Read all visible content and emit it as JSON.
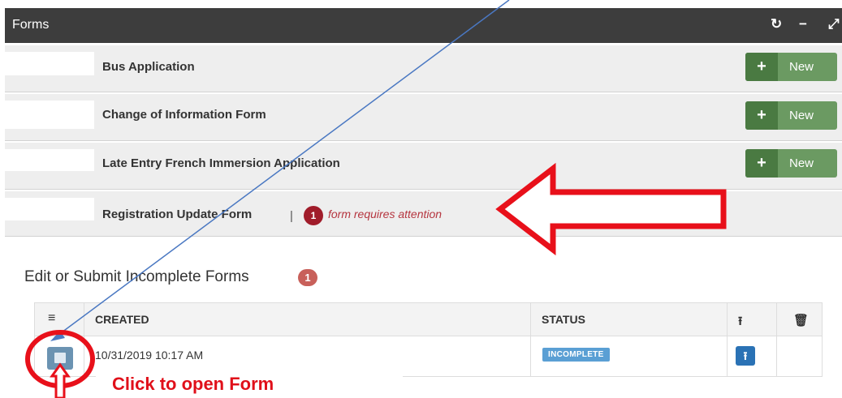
{
  "header": {
    "title": "Forms",
    "refresh_icon": "refresh-icon",
    "minimize_icon": "minus-icon",
    "expand_icon": "expand-icon"
  },
  "forms": [
    {
      "name": "Bus Application",
      "new_label": "New"
    },
    {
      "name": "Change of Information Form",
      "new_label": "New"
    },
    {
      "name": "Late Entry French Immersion Application",
      "new_label": "New"
    },
    {
      "name": "Registration Update Form",
      "separator": "|",
      "attention_count": "1",
      "attention_text": "form requires attention"
    }
  ],
  "incomplete": {
    "title": "Edit or Submit Incomplete Forms",
    "count": "1",
    "columns": {
      "created": "CREATED",
      "status": "STATUS"
    },
    "rows": [
      {
        "created": "10/31/2019 10:17 AM",
        "status": "INCOMPLETE"
      }
    ]
  },
  "annotation": {
    "caption": "Click to open Form",
    "color": "#e0101a"
  },
  "colors": {
    "header": "#3d3d3d",
    "new_button": "#6b9a62",
    "attention": "#a01c2a",
    "status": "#5a9fd4",
    "upload": "#2a72b5"
  }
}
